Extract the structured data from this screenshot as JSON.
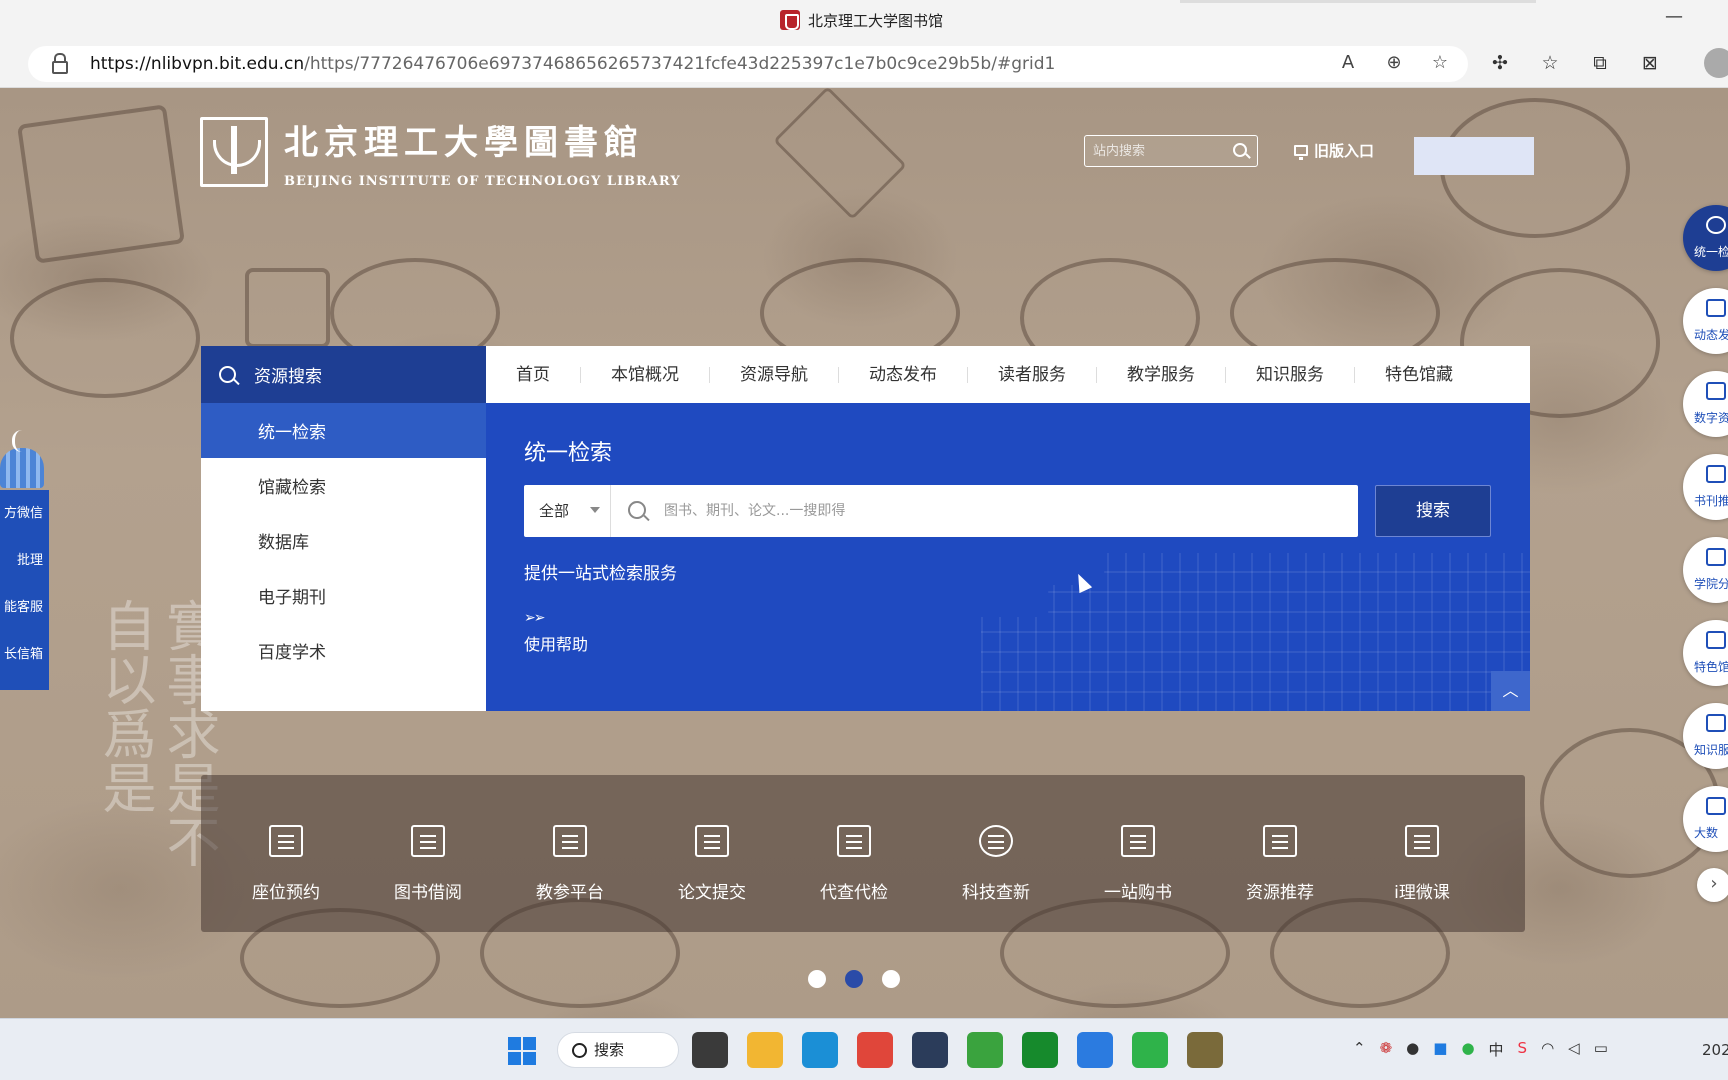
{
  "window": {
    "title": "北京理工大学图书馆",
    "minimize_glyph": "—"
  },
  "browser": {
    "url_host": "https://nlibvpn.bit.edu.cn",
    "url_path": "/https/77726476706e69737468656265737421fcfe43d225397c1e7b0c9ce29b5b/#grid1",
    "url_icons": [
      "read-aloud-icon",
      "zoom-icon",
      "add-favorite-icon"
    ],
    "toolbar_icons": [
      "extensions-icon",
      "favorites-icon",
      "collections-icon",
      "copilot-icon"
    ]
  },
  "header": {
    "logo_cn": "北京理工大學圖書館",
    "logo_en": "BEIJING INSTITUTE OF TECHNOLOGY LIBRARY",
    "site_search_placeholder": "站内搜索",
    "old_entry_label": "旧版入口"
  },
  "left_panel": {
    "items": [
      "方微信",
      "批理",
      "能客服",
      "长信箱"
    ]
  },
  "background_calligraphy": "實事求是不自以爲是",
  "right_bar": {
    "items": [
      {
        "label": "统一检",
        "icon": "search-icon",
        "active": true
      },
      {
        "label": "动态发",
        "icon": "news-icon",
        "active": false
      },
      {
        "label": "数字资",
        "icon": "layers-icon",
        "active": false
      },
      {
        "label": "书刊推",
        "icon": "book-icon",
        "active": false
      },
      {
        "label": "学院分",
        "icon": "org-icon",
        "active": false
      },
      {
        "label": "特色馆",
        "icon": "collection-icon",
        "active": false
      },
      {
        "label": "知识服",
        "icon": "knowledge-icon",
        "active": false
      },
      {
        "label": "大数",
        "icon": "chart-icon",
        "active": false
      }
    ],
    "next_glyph": "›"
  },
  "side_nav": {
    "head_label": "资源搜索",
    "items": [
      "统一检索",
      "馆藏检索",
      "数据库",
      "电子期刊",
      "百度学术"
    ],
    "active_index": 0
  },
  "top_nav": {
    "items": [
      "首页",
      "本馆概况",
      "资源导航",
      "动态发布",
      "读者服务",
      "教学服务",
      "知识服务",
      "特色馆藏"
    ]
  },
  "search_panel": {
    "title": "统一检索",
    "scope_value": "全部",
    "input_placeholder": "图书、期刊、论文...一搜即得",
    "button_label": "搜索",
    "tagline": "提供一站式检索服务",
    "help_arrows": "➢➢",
    "help_label": "使用帮助",
    "collapse_glyph": "︿"
  },
  "quick_services": [
    {
      "label": "座位预约",
      "icon": "seat-icon"
    },
    {
      "label": "图书借阅",
      "icon": "borrow-icon"
    },
    {
      "label": "教参平台",
      "icon": "teaching-ref-icon"
    },
    {
      "label": "论文提交",
      "icon": "graduation-cap-icon"
    },
    {
      "label": "代查代检",
      "icon": "check-document-icon"
    },
    {
      "label": "科技查新",
      "icon": "atom-icon"
    },
    {
      "label": "一站购书",
      "icon": "buy-book-icon"
    },
    {
      "label": "资源推荐",
      "icon": "bag-icon"
    },
    {
      "label": "i理微课",
      "icon": "video-lesson-icon"
    }
  ],
  "carousel": {
    "count": 3,
    "active_index": 1
  },
  "taskbar": {
    "search_label": "搜索",
    "apps": [
      {
        "name": "task-view-icon",
        "color": "#3a3a3a"
      },
      {
        "name": "file-explorer-icon",
        "color": "#f2b632"
      },
      {
        "name": "edge-icon",
        "color": "#1b8fd6"
      },
      {
        "name": "chrome-icon",
        "color": "#e0463a"
      },
      {
        "name": "app-cube-icon",
        "color": "#2b3c5a"
      },
      {
        "name": "browser-e-icon",
        "color": "#3aa33e"
      },
      {
        "name": "xbox-icon",
        "color": "#168a2c"
      },
      {
        "name": "app-blue-icon",
        "color": "#2b7be0"
      },
      {
        "name": "wechat-icon",
        "color": "#2fb34a"
      },
      {
        "name": "app-globe-icon",
        "color": "#7a6a3a"
      }
    ],
    "tray_icons": [
      "chevron-up-icon",
      "app-tray-icon",
      "qq-icon",
      "app-tray2-icon",
      "wechat-tray-icon",
      "ime-icon",
      "sogou-icon",
      "wifi-icon",
      "volume-icon",
      "battery-icon"
    ],
    "ime_label": "中",
    "clock_label": "202"
  },
  "colors": {
    "nav_blue": "#1e3e93",
    "content_blue": "#1f4ac0",
    "active_item": "#2e5cc4"
  }
}
